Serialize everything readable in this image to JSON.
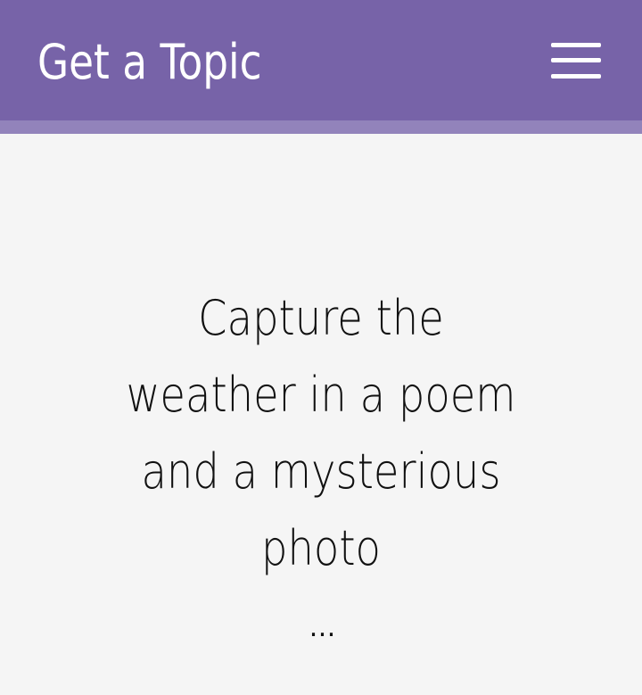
{
  "header": {
    "title": "Get a Topic",
    "menu_icon": "hamburger-menu-icon",
    "background_color": "#7763a8"
  },
  "content": {
    "topic_text": "Capture the weather in a poem and a mysterious photo",
    "ellipsis": "…"
  },
  "colors": {
    "background": "#f5f5f5",
    "text": "#111111",
    "accent": "#7763a8"
  }
}
